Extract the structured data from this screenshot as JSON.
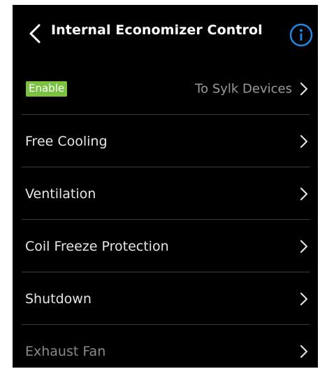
{
  "header": {
    "title": "Internal Economizer Control",
    "back_icon": "chevron-left-icon",
    "info_icon": "info-icon",
    "info_color": "#1e88e5"
  },
  "list": {
    "enable_row": {
      "badge": "Enable",
      "badge_color": "#7cc242",
      "value": "To Sylk Devices"
    },
    "items": [
      {
        "label": "Free Cooling"
      },
      {
        "label": "Ventilation"
      },
      {
        "label": "Coil Freeze Protection"
      },
      {
        "label": "Shutdown"
      },
      {
        "label": "Exhaust Fan"
      }
    ]
  }
}
